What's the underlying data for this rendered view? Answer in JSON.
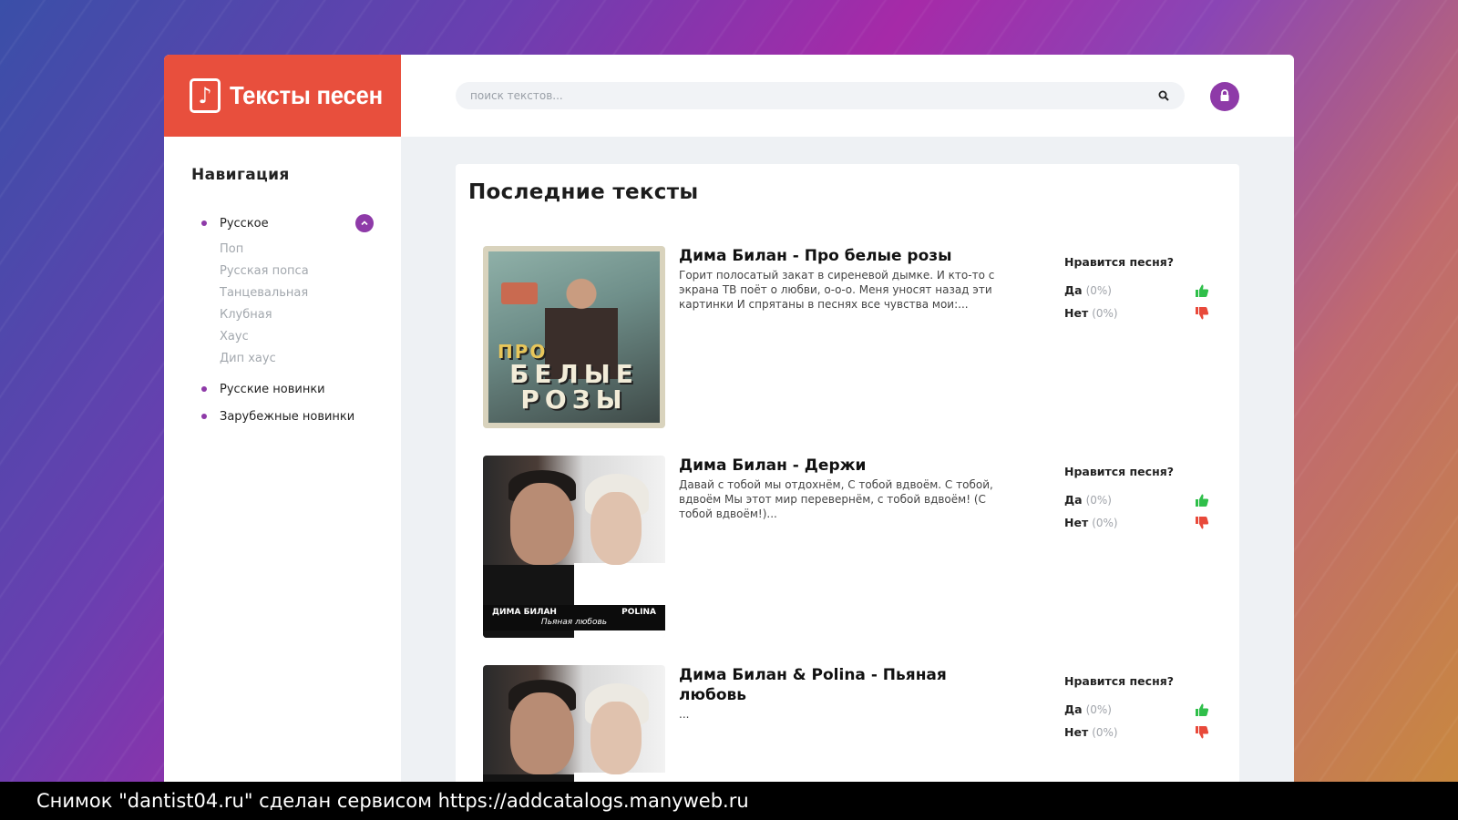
{
  "colors": {
    "brand": "#e84f3d",
    "accent": "#8e3aa8",
    "like": "#2fbf4a",
    "dislike": "#e8493a"
  },
  "logo": {
    "icon": "music-note-icon",
    "text": "Тексты песен"
  },
  "search": {
    "placeholder": "поиск текстов...",
    "icon": "search-icon"
  },
  "account": {
    "icon": "lock-icon"
  },
  "sidebar": {
    "title": "Навигация",
    "items": [
      {
        "label": "Русское",
        "expanded": true,
        "children": [
          "Поп",
          "Русская попса",
          "Танцевальная",
          "Клубная",
          "Хаус",
          "Дип хаус"
        ]
      },
      {
        "label": "Русские новинки"
      },
      {
        "label": "Зарубежные новинки"
      }
    ]
  },
  "main": {
    "title": "Последние тексты",
    "cards": [
      {
        "title": "Дима Билан - Про белые розы",
        "excerpt": "Горит полосатый закат в сиреневой дымке. И кто-то с экрана ТВ поёт о любви, о-о-о. Меня уносят назад эти картинки И спрятаны в песнях все чувства мои:...",
        "cover_text": [
          "ПРО",
          "БЕЛЫЕ",
          "РОЗЫ"
        ],
        "vote_question": "Нравится песня?",
        "yes_label": "Да",
        "yes_pct": "(0%)",
        "no_label": "Нет",
        "no_pct": "(0%)"
      },
      {
        "title": "Дима Билан - Держи",
        "excerpt": "Давай с тобой мы отдохнём, С тобой вдвоём. С тобой, вдвоём Мы этот мир перевернём, с тобой вдвоём! (С тобой вдвоём!)...",
        "cover_text": [
          "ДИМА БИЛАН",
          "POLINA",
          "Пьяная любовь"
        ],
        "vote_question": "Нравится песня?",
        "yes_label": "Да",
        "yes_pct": "(0%)",
        "no_label": "Нет",
        "no_pct": "(0%)"
      },
      {
        "title": "Дима Билан & Polina - Пьяная любовь",
        "excerpt": "...",
        "vote_question": "Нравится песня?",
        "yes_label": "Да",
        "yes_pct": "(0%)",
        "no_label": "Нет",
        "no_pct": "(0%)"
      }
    ]
  },
  "footer": {
    "text": "Снимок \"dantist04.ru\" сделан сервисом https://addcatalogs.manyweb.ru"
  }
}
